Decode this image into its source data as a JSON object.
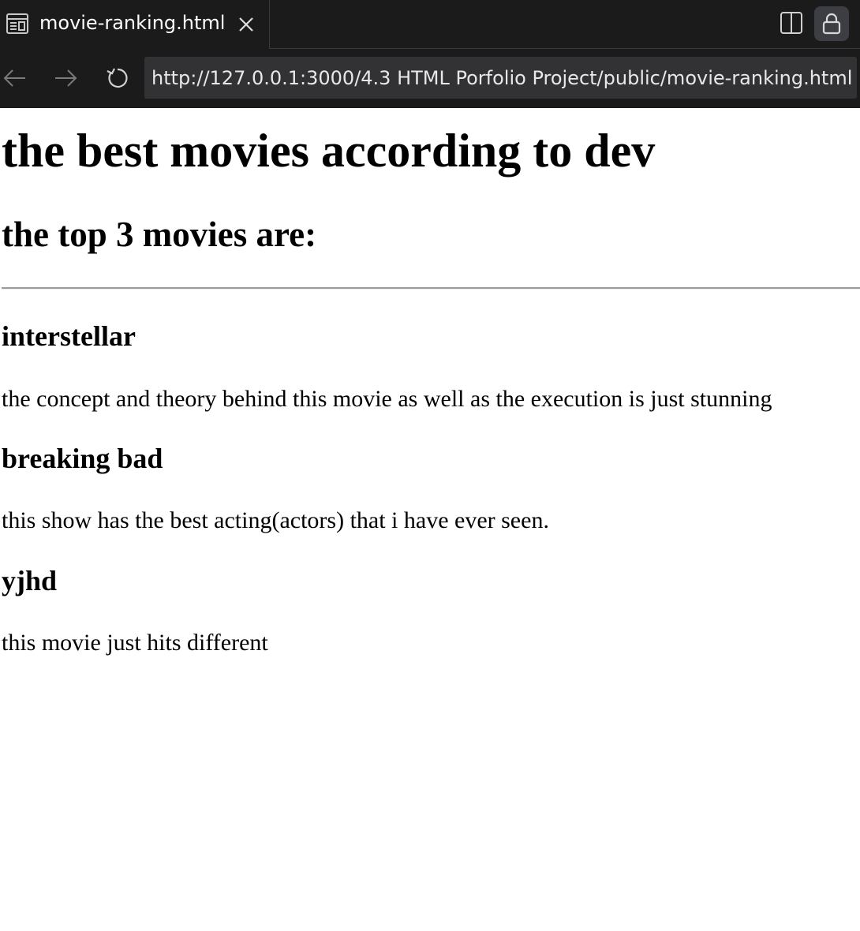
{
  "browser": {
    "tab": {
      "title": "movie-ranking.html",
      "icon": "page-preview-icon"
    },
    "toolbar_icons": [
      "split-view-icon",
      "lock-icon"
    ],
    "nav_icons": [
      "back-arrow-icon",
      "forward-arrow-icon",
      "reload-icon"
    ],
    "url": "http://127.0.0.1:3000/4.3 HTML Porfolio Project/public/movie-ranking.html"
  },
  "page": {
    "heading": "the best movies according to dev",
    "subheading": "the top 3 movies are:",
    "movies": [
      {
        "title": "interstellar",
        "description": "the concept and theory behind this movie as well as the execution is just stunning"
      },
      {
        "title": "breaking bad",
        "description": "this show has the best acting(actors) that i have ever seen."
      },
      {
        "title": "yjhd",
        "description": "this movie just hits different"
      }
    ]
  },
  "colors": {
    "chrome_background": "#1b1b1c",
    "urlbar_background": "#323235",
    "lock_button_background": "#3d3e43",
    "page_background": "#ffffff",
    "text": "#000000"
  }
}
